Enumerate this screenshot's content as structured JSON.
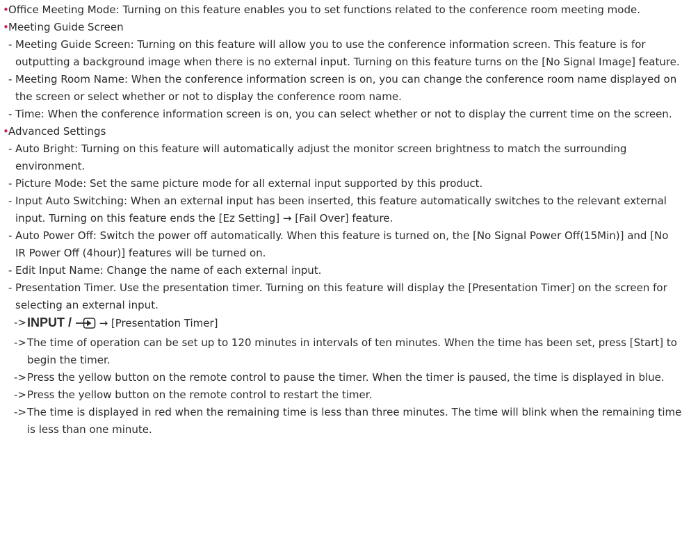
{
  "bullet_glyph": "•",
  "dash_glyph": "-",
  "arrow_glyph": "->",
  "accent_color": "#c6214f",
  "icons": [
    "input-source-icon"
  ],
  "items": [
    {
      "text": "Office Meeting Mode: Turning on this feature enables you to set functions related to the conference room meeting mode."
    },
    {
      "text": "Meeting Guide Screen",
      "subs": [
        "Meeting Guide Screen: Turning on this feature will allow you to use the conference information screen. This feature is for outputting a background image when there is no external input. Turning on this feature turns on the [No Signal Image] feature.",
        "Meeting Room Name: When the conference information screen is on, you can change the conference room name displayed on the screen or select whether or not to display the conference room name.",
        "Time: When the conference information screen is on, you can select whether or not to display the current time on the screen."
      ]
    },
    {
      "text": "Advanced Settings",
      "subs": [
        "Auto Bright: Turning on this feature will automatically adjust the monitor screen brightness to match the surrounding environment.",
        "Picture Mode: Set the same picture mode for all external input supported by this product.",
        "Input Auto Switching: When an external input has been inserted, this feature automatically switches to the relevant external input. Turning on this feature ends the [Ez Setting] → [Fail Over] feature.",
        "Auto Power Off: Switch the power off automatically. When this feature is turned on, the [No Signal Power Off(15Min)] and [No IR Power Off (4hour)] features will be turned on.",
        "Edit Input Name: Change the name of each external input.",
        "Presentation Timer. Use the presentation timer. Turning on this feature will display the [Presentation Timer] on the screen for selecting an external input."
      ],
      "timer_nav": {
        "key_label": "INPUT /",
        "after_icon": "→ [Presentation Timer]"
      },
      "timer_notes": [
        "The time of operation can be set up to 120 minutes in intervals of ten minutes. When the time has been set, press [Start] to begin the timer.",
        "Press the yellow button on the remote control to pause the timer. When the timer is paused, the time is displayed in blue.",
        "Press the yellow button on the remote control to restart the timer.",
        "The time is displayed in red when the remaining time is less than three minutes. The time will blink when the remaining time is less than one minute."
      ]
    }
  ]
}
